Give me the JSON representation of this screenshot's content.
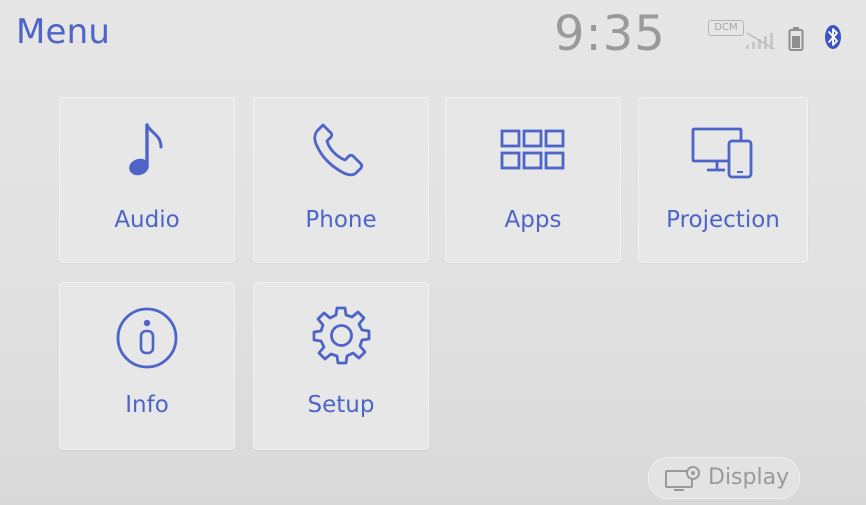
{
  "header": {
    "title": "Menu",
    "time": "9:35",
    "status": {
      "dcm_label": "DCM",
      "signal_icon": "signal-strength-icon",
      "battery_icon": "battery-icon",
      "bluetooth_icon": "bluetooth-icon"
    }
  },
  "menu": {
    "items": [
      {
        "label": "Audio",
        "icon": "music-note-icon"
      },
      {
        "label": "Phone",
        "icon": "phone-handset-icon"
      },
      {
        "label": "Apps",
        "icon": "apps-grid-icon"
      },
      {
        "label": "Projection",
        "icon": "projection-devices-icon"
      },
      {
        "label": "Info",
        "icon": "info-icon"
      },
      {
        "label": "Setup",
        "icon": "gear-icon"
      }
    ]
  },
  "footer": {
    "display_label": "Display",
    "display_icon": "display-settings-icon"
  },
  "colors": {
    "accent": "#4d64c8",
    "muted": "#9a9a9a",
    "background": "#e2e2e2"
  }
}
